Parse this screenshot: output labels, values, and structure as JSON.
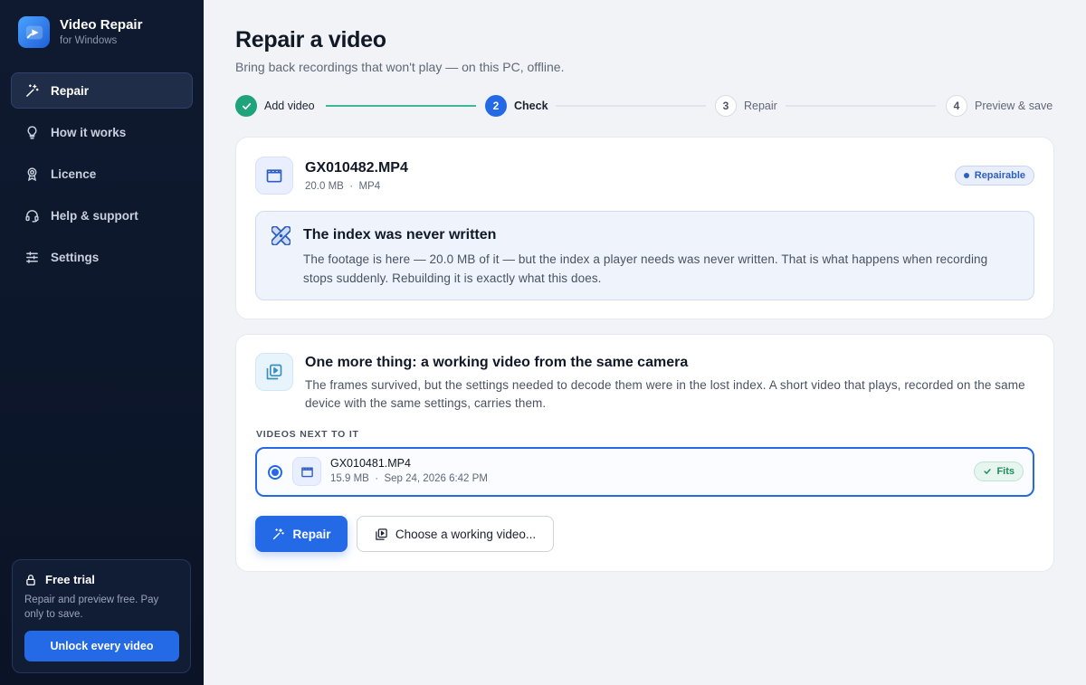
{
  "app": {
    "name": "Video Repair",
    "platform": "for Windows"
  },
  "sidebar": {
    "items": [
      {
        "label": "Repair",
        "icon": "magic-wand-icon",
        "active": true
      },
      {
        "label": "How it works",
        "icon": "lightbulb-icon",
        "active": false
      },
      {
        "label": "Licence",
        "icon": "award-icon",
        "active": false
      },
      {
        "label": "Help & support",
        "icon": "headset-icon",
        "active": false
      },
      {
        "label": "Settings",
        "icon": "sliders-icon",
        "active": false
      }
    ],
    "trial": {
      "title": "Free trial",
      "body": "Repair and preview free. Pay only to save.",
      "button": "Unlock every video"
    }
  },
  "header": {
    "title": "Repair a video",
    "subtitle": "Bring back recordings that won't play — on this PC, offline."
  },
  "stepper": {
    "steps": [
      {
        "number": "1",
        "label": "Add video",
        "state": "done"
      },
      {
        "number": "2",
        "label": "Check",
        "state": "current"
      },
      {
        "number": "3",
        "label": "Repair",
        "state": "todo"
      },
      {
        "number": "4",
        "label": "Preview & save",
        "state": "todo"
      }
    ]
  },
  "file": {
    "name": "GX010482.MP4",
    "size": "20.0 MB",
    "separator": "·",
    "format": "MP4",
    "status": "Repairable"
  },
  "diagnosis": {
    "title": "The index was never written",
    "body": "The footage is here — 20.0 MB of it — but the index a player needs was never written. That is what happens when recording stops suddenly. Rebuilding it is exactly what this does."
  },
  "reference": {
    "title": "One more thing: a working video from the same camera",
    "body": "The frames survived, but the settings needed to decode them were in the lost index. A short video that plays, recorded on the same device with the same settings, carries them.",
    "section_label": "VIDEOS NEXT TO IT",
    "candidates": [
      {
        "name": "GX010481.MP4",
        "size": "15.9 MB",
        "separator": "·",
        "date": "Sep 24, 2026 6:42 PM",
        "badge": "Fits",
        "selected": true
      }
    ]
  },
  "actions": {
    "primary": "Repair",
    "secondary": "Choose a working video..."
  },
  "colors": {
    "accent": "#2469e6",
    "success": "#1fa37a",
    "sidebar_bg": "#0f1a30",
    "page_bg": "#f1f3f7"
  }
}
